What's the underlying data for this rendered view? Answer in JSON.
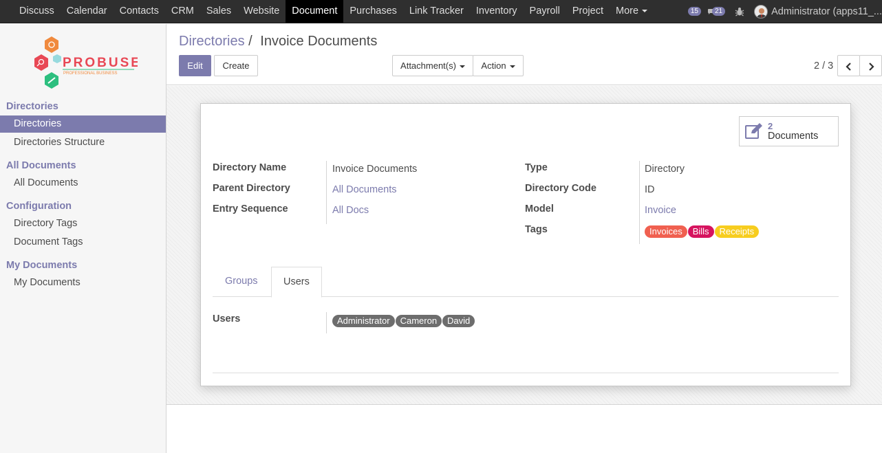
{
  "topbar": {
    "menu": [
      "Discuss",
      "Calendar",
      "Contacts",
      "CRM",
      "Sales",
      "Website",
      "Document",
      "Purchases",
      "Link Tracker",
      "Inventory",
      "Payroll",
      "Project",
      "More"
    ],
    "active_menu": "Document",
    "messages_count": "15",
    "chat_count": "21",
    "user": "Administrator (apps11_..."
  },
  "logo": {
    "name": "PROBUSE",
    "tagline": "PROFESSIONAL BUSINESS"
  },
  "sidebar": {
    "sections": [
      {
        "title": "Directories",
        "items": [
          "Directories",
          "Directories Structure"
        ]
      },
      {
        "title": "All Documents",
        "items": [
          "All Documents"
        ]
      },
      {
        "title": "Configuration",
        "items": [
          "Directory Tags",
          "Document Tags"
        ]
      },
      {
        "title": "My Documents",
        "items": [
          "My Documents"
        ]
      }
    ],
    "active_item": "Directories"
  },
  "breadcrumb": {
    "parent": "Directories",
    "separator": "/",
    "current": "Invoice Documents"
  },
  "buttons": {
    "edit": "Edit",
    "create": "Create",
    "attachments": "Attachment(s)",
    "action": "Action"
  },
  "pager": {
    "value": "2 / 3"
  },
  "stat_button": {
    "count": "2",
    "label": "Documents"
  },
  "form": {
    "left": [
      {
        "label": "Directory Name",
        "value": "Invoice Documents",
        "link": false
      },
      {
        "label": "Parent Directory",
        "value": "All Documents",
        "link": true
      },
      {
        "label": "Entry Sequence",
        "value": "All Docs",
        "link": true
      }
    ],
    "right": [
      {
        "label": "Type",
        "value": "Directory",
        "link": false
      },
      {
        "label": "Directory Code",
        "value": "ID",
        "link": false
      },
      {
        "label": "Model",
        "value": "Invoice",
        "link": true
      },
      {
        "label": "Tags",
        "value": "",
        "link": false
      }
    ],
    "tags": [
      {
        "name": "Invoices",
        "color": "#f06050"
      },
      {
        "name": "Bills",
        "color": "#d6145f"
      },
      {
        "name": "Receipts",
        "color": "#f7cd1f"
      }
    ]
  },
  "tabs": {
    "groups": "Groups",
    "users": "Users",
    "active": "Users"
  },
  "users_field": {
    "label": "Users",
    "users": [
      "Administrator",
      "Cameron",
      "David"
    ]
  },
  "colors": {
    "accent": "#7c7bad",
    "topbar": "#2f2f2f",
    "user_tag": "#6d6d6d"
  }
}
